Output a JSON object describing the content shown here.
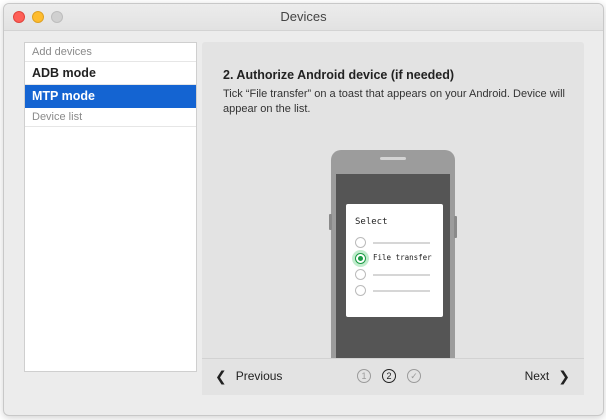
{
  "window": {
    "title": "Devices"
  },
  "sidebar": {
    "section_add": "Add devices",
    "items": [
      {
        "label": "ADB mode",
        "active": false
      },
      {
        "label": "MTP mode",
        "active": true
      }
    ],
    "section_list": "Device list"
  },
  "main": {
    "heading": "2. Authorize Android device (if needed)",
    "description": "Tick “File transfer” on a toast that appears on your Android. Device will appear on the list.",
    "illustration": {
      "dialog_title": "Select",
      "selected_option": "File transfer"
    }
  },
  "footer": {
    "previous_label": "Previous",
    "next_label": "Next",
    "steps": [
      "1",
      "2",
      "✓"
    ],
    "current_step": 2
  },
  "colors": {
    "accent": "#1464d2",
    "selected_radio": "#1a9a44"
  }
}
